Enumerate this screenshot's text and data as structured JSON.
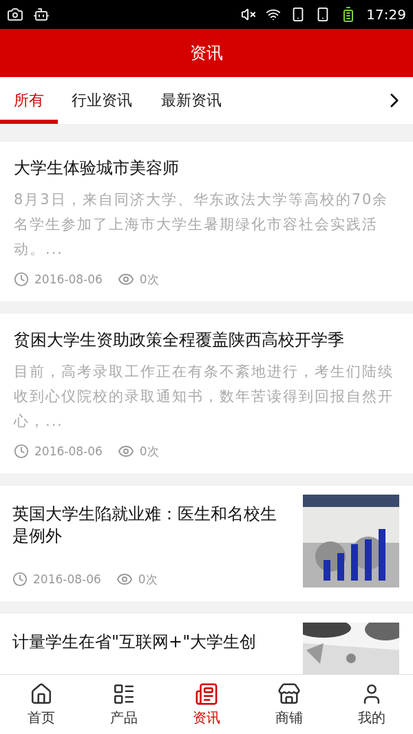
{
  "status_bar": {
    "time": "17:29"
  },
  "header": {
    "title": "资讯"
  },
  "tabs": [
    {
      "label": "所有",
      "selected": true
    },
    {
      "label": "行业资讯",
      "selected": false
    },
    {
      "label": "最新资讯",
      "selected": false
    }
  ],
  "articles": [
    {
      "kind": "text",
      "title": "大学生体验城市美容师",
      "summary": "8月3日，来自同济大学、华东政法大学等高校的70余名学生参加了上海市大学生暑期绿化市容社会实践活动。...",
      "date": "2016-08-06",
      "views": "0次"
    },
    {
      "kind": "text",
      "title": "贫困大学生资助政策全程覆盖陕西高校开学季",
      "summary": "目前，高考录取工作正在有条不紊地进行，考生们陆续收到心仪院校的录取通知书，数年苦读得到回报自然开心，...",
      "date": "2016-08-06",
      "views": "0次"
    },
    {
      "title": "英国大学生陷就业难：医生和名校生是例外",
      "date": "2016-08-06",
      "views": "0次"
    },
    {
      "title": "计量学生在省\"互联网+\"大学生创"
    }
  ],
  "nav": [
    {
      "label": "首页",
      "kind": "home",
      "selected": false
    },
    {
      "label": "产品",
      "kind": "list",
      "selected": false
    },
    {
      "label": "资讯",
      "kind": "news",
      "selected": true
    },
    {
      "label": "商铺",
      "kind": "store",
      "selected": false
    },
    {
      "label": "我的",
      "kind": "user",
      "selected": false
    }
  ]
}
